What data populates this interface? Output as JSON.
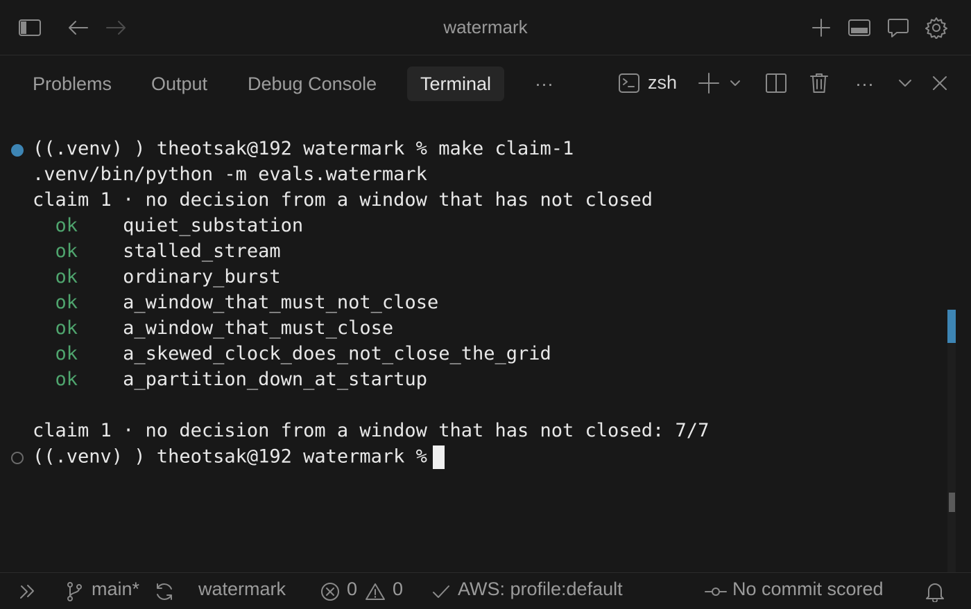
{
  "window": {
    "title": "watermark"
  },
  "panel": {
    "tabs": [
      {
        "label": "Problems"
      },
      {
        "label": "Output"
      },
      {
        "label": "Debug Console"
      },
      {
        "label": "Terminal",
        "active": true
      }
    ],
    "more_tabs_label": "···",
    "shell_name": "zsh",
    "more_actions_label": "···"
  },
  "terminal": {
    "prompt": "((.venv) ) theotsak@192 watermark % ",
    "command": "make claim-1",
    "output_line_1": ".venv/bin/python -m evals.watermark",
    "claim_header": "claim 1 · no decision from a window that has not closed",
    "results": [
      {
        "status": "ok",
        "name": "quiet_substation"
      },
      {
        "status": "ok",
        "name": "stalled_stream"
      },
      {
        "status": "ok",
        "name": "ordinary_burst"
      },
      {
        "status": "ok",
        "name": "a_window_that_must_not_close"
      },
      {
        "status": "ok",
        "name": "a_window_that_must_close"
      },
      {
        "status": "ok",
        "name": "a_skewed_clock_does_not_close_the_grid"
      },
      {
        "status": "ok",
        "name": "a_partition_down_at_startup"
      }
    ],
    "summary": "claim 1 · no decision from a window that has not closed: 7/7",
    "prompt_2": "((.venv) ) theotsak@192 watermark %"
  },
  "statusbar": {
    "branch": "main*",
    "folder": "watermark",
    "errors": "0",
    "warnings": "0",
    "aws": "AWS: profile:default",
    "commit": "No commit scored"
  },
  "colors": {
    "background": "#181818",
    "accent": "#3d85b4",
    "ok_green": "#4fa56e"
  },
  "icons": [
    "sidebar-toggle-icon",
    "back-arrow-icon",
    "forward-arrow-icon",
    "plus-icon",
    "panel-toggle-icon",
    "chat-icon",
    "gear-icon",
    "terminal-icon",
    "plus-icon",
    "chevron-down-icon",
    "split-icon",
    "trash-icon",
    "chevron-down-icon",
    "close-icon",
    "remote-icon",
    "branch-icon",
    "sync-icon",
    "error-icon",
    "warning-icon",
    "check-icon",
    "commit-icon",
    "bell-icon"
  ]
}
